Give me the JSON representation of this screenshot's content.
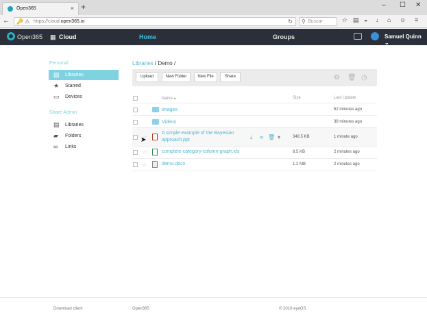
{
  "browser": {
    "tab_title": "Open365",
    "url_prefix": "https://cloud.",
    "url_domain": "open365.io",
    "search_placeholder": "Buscar"
  },
  "app": {
    "logo": "Open365",
    "name": "Cloud",
    "nav": {
      "home": "Home",
      "groups": "Groups"
    },
    "user": "Samuel Quinn"
  },
  "sidebar": {
    "personal_header": "Personal",
    "personal_items": [
      {
        "label": "Libraries",
        "icon": "libraries-icon",
        "active": true
      },
      {
        "label": "Starred",
        "icon": "star-icon",
        "active": false
      },
      {
        "label": "Devices",
        "icon": "monitor-icon",
        "active": false
      }
    ],
    "admin_header": "Share Admin",
    "admin_items": [
      {
        "label": "Libraries",
        "icon": "libraries-icon"
      },
      {
        "label": "Folders",
        "icon": "folder-icon"
      },
      {
        "label": "Links",
        "icon": "link-icon"
      }
    ]
  },
  "breadcrumb": {
    "root": "Libraries",
    "sep": "/",
    "current": "Demo /"
  },
  "toolbar": {
    "upload": "Upload",
    "new_folder": "New Folder",
    "new_file": "New File",
    "share": "Share"
  },
  "table": {
    "headers": {
      "name": "Name ▴",
      "size": "Size",
      "last_update": "Last Update"
    },
    "rows": [
      {
        "name": "Images",
        "type": "folder",
        "size": "",
        "updated": "52 minutes ago"
      },
      {
        "name": "Videos",
        "type": "folder",
        "size": "",
        "updated": "38 minutes ago"
      },
      {
        "name": "A simple example of the Bayesian",
        "name2": "approach.ppt",
        "type": "ppt",
        "size": "348.5 KB",
        "updated": "1 minute ago"
      },
      {
        "name": "complete-category-column-graph.xls",
        "type": "xls",
        "size": "8.5 KB",
        "updated": "2 minutes ago"
      },
      {
        "name": "demo.docx",
        "type": "doc",
        "size": "1.2 MB",
        "updated": "2 minutes ago"
      }
    ]
  },
  "footer": {
    "download": "Download client",
    "brand": "Open365",
    "copyright": "© 2016 eyeOS"
  },
  "colors": {
    "accent": "#4fb5cf",
    "header_bg": "#2b2f3a",
    "active_bg": "#7fd3e1"
  }
}
